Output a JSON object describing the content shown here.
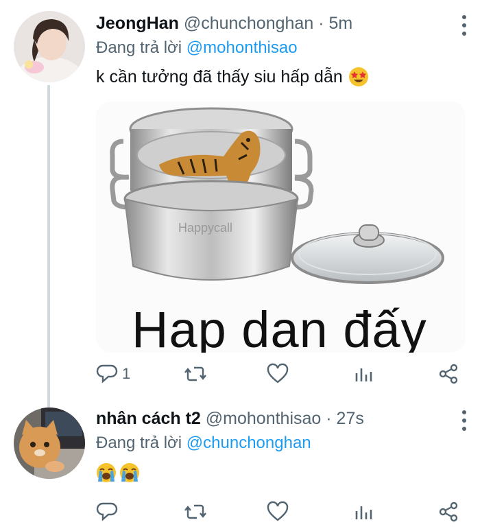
{
  "tweets": [
    {
      "name": "JeongHan",
      "handle": "@chunchonghan",
      "time": "· 5m",
      "reply_prefix": "Đang trả lời",
      "reply_handle": "@mohonthisao",
      "text": "k cần tưởng đã thấy siu hấp dẫn",
      "emoji": "star-struck-emoji",
      "media_caption": "Hap dan đấy",
      "media_watermark": "Happycall",
      "actions": {
        "reply_count": "1",
        "retweet_count": "",
        "like_count": ""
      }
    },
    {
      "name": "nhân cách t2",
      "handle": "@mohonthisao",
      "time": "· 27s",
      "reply_prefix": "Đang trả lời",
      "reply_handle": "@chunchonghan",
      "emoji": "loudly-crying-emoji x2",
      "actions": {
        "reply_count": "",
        "retweet_count": "",
        "like_count": ""
      }
    }
  ],
  "colors": {
    "accent": "#1d9bf0",
    "muted": "#536471",
    "text": "#0f1419",
    "thread_line": "#cfd9de"
  },
  "icons": [
    "more-vertical-icon",
    "reply-icon",
    "retweet-icon",
    "like-icon",
    "analytics-icon",
    "share-icon"
  ]
}
